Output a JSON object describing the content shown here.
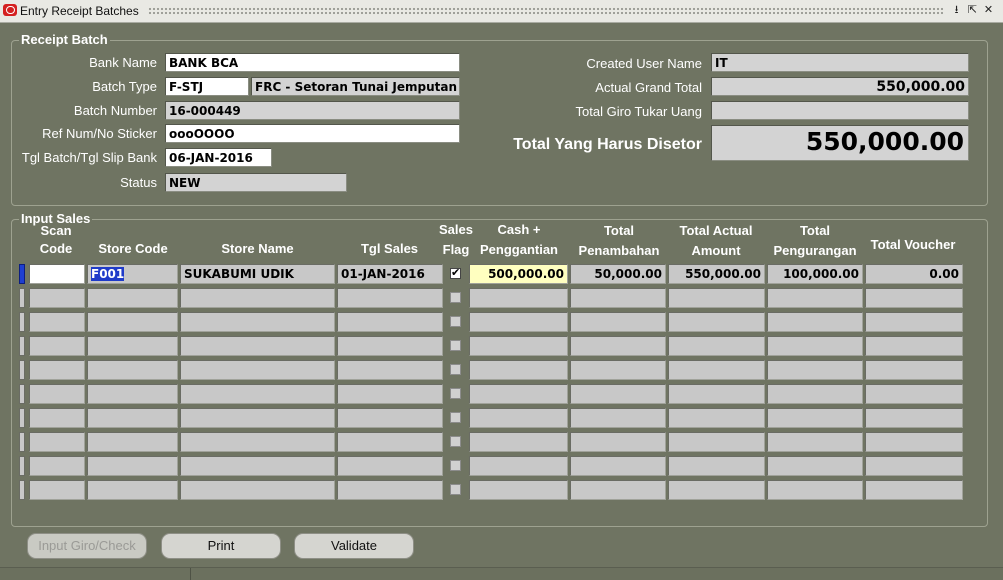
{
  "window": {
    "title": "Entry Receipt Batches"
  },
  "receipt_batch": {
    "group_title": "Receipt Batch",
    "bank_name_label": "Bank Name",
    "bank_name": "BANK BCA",
    "batch_type_label": "Batch Type",
    "batch_type_code": "F-STJ",
    "batch_type_desc": "FRC - Setoran Tunai Jemputan",
    "batch_number_label": "Batch Number",
    "batch_number": "16-000449",
    "ref_num_label": "Ref Num/No Sticker",
    "ref_num": "oooOOOO",
    "tgl_batch_label": "Tgl Batch/Tgl Slip Bank",
    "tgl_batch": "06-JAN-2016",
    "status_label": "Status",
    "status": "NEW",
    "created_user_label": "Created User Name",
    "created_user": "IT",
    "actual_grand_total_label": "Actual Grand Total",
    "actual_grand_total": "550,000.00",
    "total_giro_label": "Total Giro Tukar Uang",
    "total_giro": "",
    "total_disetor_label": "Total Yang Harus Disetor",
    "total_disetor": "550,000.00"
  },
  "input_sales": {
    "group_title": "Input Sales",
    "headers": {
      "scan_code": "Scan Code",
      "store_code": "Store Code",
      "store_name": "Store Name",
      "tgl_sales": "Tgl Sales",
      "sales_flag": "Sales Flag",
      "cash_penggantian": "Cash + Penggantian",
      "total_penambahan": "Total Penambahan",
      "total_actual_amount": "Total Actual Amount",
      "total_pengurangan": "Total Pengurangan",
      "total_voucher": "Total Voucher"
    },
    "rows": [
      {
        "scan_code": "",
        "store_code": "F001",
        "store_name": "SUKABUMI UDIK",
        "tgl_sales": "01-JAN-2016",
        "sales_flag": true,
        "cash_penggantian": "500,000.00",
        "total_penambahan": "50,000.00",
        "total_actual_amount": "550,000.00",
        "total_pengurangan": "100,000.00",
        "total_voucher": "0.00"
      }
    ]
  },
  "buttons": {
    "input_giro": "Input Giro/Check",
    "print": "Print",
    "validate": "Validate"
  }
}
